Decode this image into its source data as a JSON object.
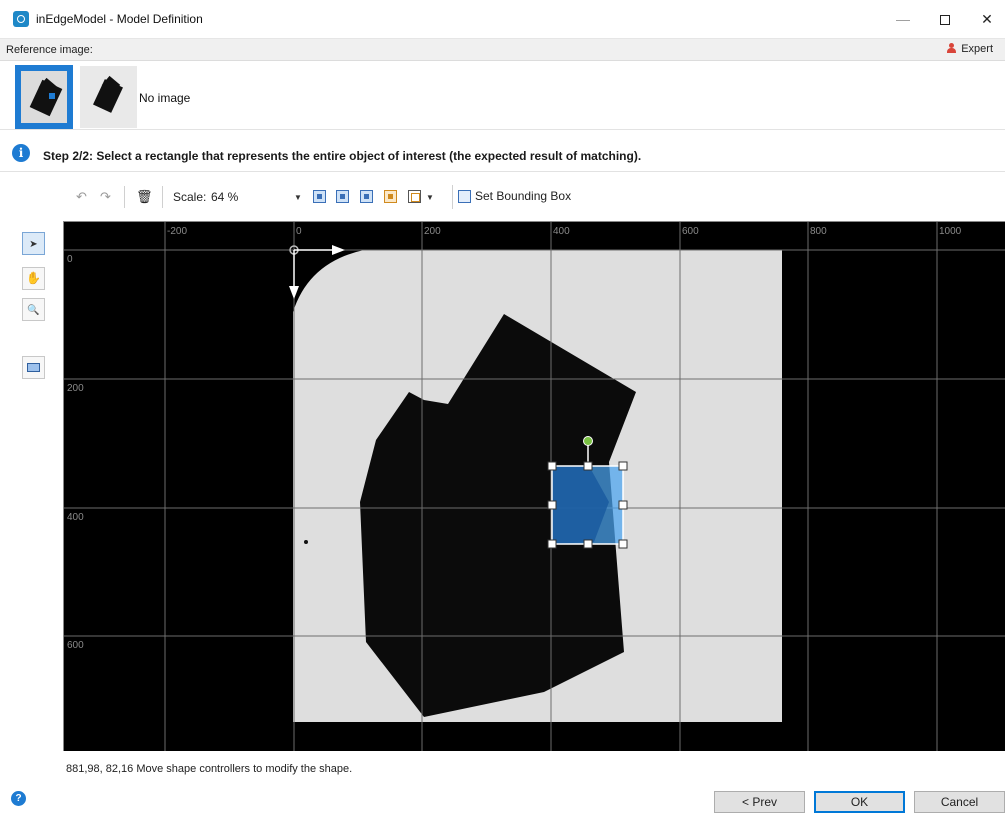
{
  "window": {
    "title": "inEdgeModel - Model Definition",
    "minimize_glyph": "—",
    "maximize_glyph": "",
    "close_glyph": "✕"
  },
  "reference": {
    "label": "Reference image:",
    "mode_label": "Expert",
    "no_image_text": "No image"
  },
  "step": {
    "info_glyph": "i",
    "text": "Step 2/2: Select a rectangle that represents the entire object of interest (the expected result of matching)."
  },
  "toolbar": {
    "undo_glyph": "↶",
    "redo_glyph": "↷",
    "delete_glyph": "🗑",
    "scale_label": "Scale:",
    "scale_value": "64 %",
    "set_bounding_box_label": "Set Bounding Box"
  },
  "tools": {
    "pointer_glyph": "➤",
    "pan_glyph": "✋",
    "zoom_glyph": "🔍"
  },
  "canvas": {
    "x_ticks": [
      "-200",
      "0",
      "200",
      "400",
      "600",
      "800",
      "1000"
    ],
    "y_ticks": [
      "0",
      "200",
      "400",
      "600"
    ]
  },
  "status": {
    "text": "881,98, 82,16  Move shape controllers to modify the shape."
  },
  "buttons": {
    "help_glyph": "?",
    "prev": "< Prev",
    "ok": "OK",
    "cancel": "Cancel"
  },
  "colors": {
    "accent": "#1e7bd2",
    "selection_fill": "#4aa3f0",
    "rotation_handle": "#7ac143"
  }
}
